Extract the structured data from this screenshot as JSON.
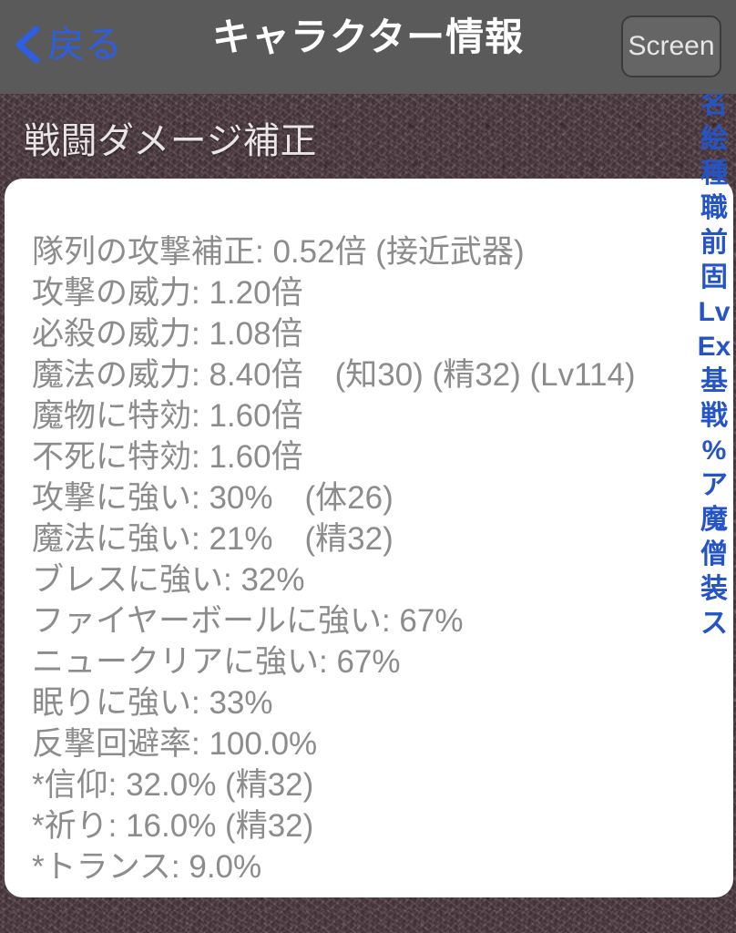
{
  "navbar": {
    "back_label": "戻る",
    "back_icon": "chevron-left-icon",
    "title": "キャラクター情報",
    "screen_button_label": "Screen",
    "accent_color": "#2f5fe0",
    "bar_color": "#5a5a5a"
  },
  "section": {
    "title": "戦闘ダメージ補正"
  },
  "stats": {
    "text_color": "#8c8c8c",
    "lines": [
      "隊列の攻撃補正: 0.52倍 (接近武器)",
      "攻撃の威力: 1.20倍",
      "必殺の威力: 1.08倍",
      "魔法の威力: 8.40倍　(知30) (精32) (Lv114)",
      "魔物に特効: 1.60倍",
      "不死に特効: 1.60倍",
      "攻撃に強い: 30%　(体26)",
      "魔法に強い: 21%　(精32)",
      "ブレスに強い: 32%",
      "ファイヤーボールに強い: 67%",
      "ニュークリアに強い: 67%",
      "眠りに強い: 33%",
      "反撃回避率: 100.0%",
      "*信仰: 32.0% (精32)",
      "*祈り: 16.0% (精32)",
      "*トランス: 9.0%"
    ]
  },
  "index_strip": {
    "color": "#2554c7",
    "items": [
      "名",
      "絵",
      "種",
      "職",
      "前",
      "固",
      "Lv",
      "Ex",
      "基",
      "戦",
      "%",
      "ア",
      "魔",
      "僧",
      "装",
      "ス"
    ]
  }
}
